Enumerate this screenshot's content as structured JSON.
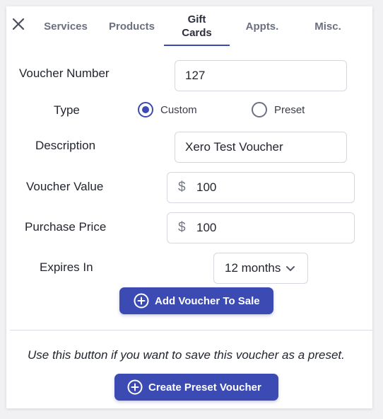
{
  "tabs": [
    {
      "label": "Services"
    },
    {
      "label": "Products"
    },
    {
      "label": "Gift\nCards"
    },
    {
      "label": "Appts."
    },
    {
      "label": "Misc."
    }
  ],
  "active_tab": "Gift Cards",
  "form": {
    "voucher_number": {
      "label": "Voucher Number",
      "value": "127"
    },
    "type": {
      "label": "Type",
      "options": [
        "Custom",
        "Preset"
      ],
      "selected": "Custom"
    },
    "description": {
      "label": "Description",
      "value": "Xero Test Voucher"
    },
    "voucher_value": {
      "label": "Voucher Value",
      "currency": "$",
      "value": "100"
    },
    "purchase_price": {
      "label": "Purchase Price",
      "currency": "$",
      "value": "100"
    },
    "expires_in": {
      "label": "Expires In",
      "value": "12 months"
    }
  },
  "buttons": {
    "add_voucher": "Add Voucher To Sale",
    "create_preset": "Create Preset Voucher"
  },
  "preset_note": "Use this button if you want to save this voucher as a preset.",
  "icons": {
    "close": "close-icon",
    "add": "plus-circle-icon",
    "dropdown": "chevron-down-icon"
  },
  "colors": {
    "accent": "#3c4bb3",
    "muted_text": "#6b7080"
  }
}
